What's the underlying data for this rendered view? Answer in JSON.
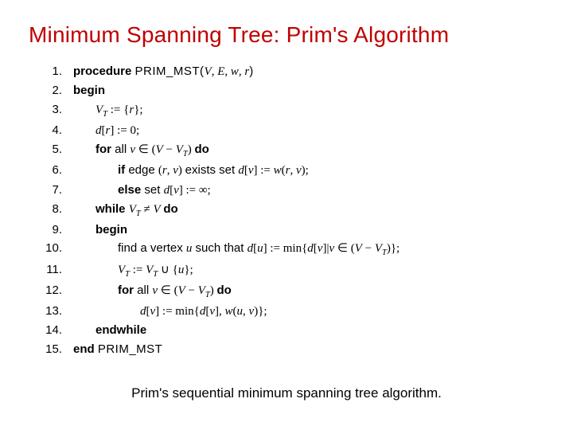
{
  "title": "Minimum Spanning Tree: Prim's Algorithm",
  "caption": "Prim's sequential minimum spanning tree algorithm.",
  "algo": {
    "lines": [
      {
        "n": "1.",
        "indent": 0,
        "parts": [
          {
            "t": "kw",
            "s": "procedure "
          },
          {
            "t": "sc",
            "s": "PRIM_MST("
          },
          {
            "t": "mi",
            "s": "V"
          },
          {
            "t": "m",
            "s": ", "
          },
          {
            "t": "mi",
            "s": "E"
          },
          {
            "t": "m",
            "s": ", "
          },
          {
            "t": "mi",
            "s": "w"
          },
          {
            "t": "m",
            "s": ", "
          },
          {
            "t": "mi",
            "s": "r"
          },
          {
            "t": "sc",
            "s": ")"
          }
        ]
      },
      {
        "n": "2.",
        "indent": 0,
        "parts": [
          {
            "t": "kw",
            "s": "begin"
          }
        ]
      },
      {
        "n": "3.",
        "indent": 1,
        "parts": [
          {
            "t": "mi",
            "s": "V"
          },
          {
            "t": "sub",
            "s": "T"
          },
          {
            "t": "m",
            "s": " := {"
          },
          {
            "t": "mi",
            "s": "r"
          },
          {
            "t": "m",
            "s": "};"
          }
        ]
      },
      {
        "n": "4.",
        "indent": 1,
        "parts": [
          {
            "t": "mi",
            "s": "d"
          },
          {
            "t": "m",
            "s": "["
          },
          {
            "t": "mi",
            "s": "r"
          },
          {
            "t": "m",
            "s": "] := 0;"
          }
        ]
      },
      {
        "n": "5.",
        "indent": 1,
        "parts": [
          {
            "t": "kw",
            "s": "for "
          },
          {
            "t": "txt",
            "s": "all "
          },
          {
            "t": "mi",
            "s": "v"
          },
          {
            "t": "m",
            "s": " ∈ ("
          },
          {
            "t": "mi",
            "s": "V"
          },
          {
            "t": "m",
            "s": " − "
          },
          {
            "t": "mi",
            "s": "V"
          },
          {
            "t": "sub",
            "s": "T"
          },
          {
            "t": "m",
            "s": ") "
          },
          {
            "t": "kw",
            "s": "do"
          }
        ]
      },
      {
        "n": "6.",
        "indent": 2,
        "parts": [
          {
            "t": "kw",
            "s": "if "
          },
          {
            "t": "txt",
            "s": "edge "
          },
          {
            "t": "m",
            "s": "("
          },
          {
            "t": "mi",
            "s": "r"
          },
          {
            "t": "m",
            "s": ", "
          },
          {
            "t": "mi",
            "s": "v"
          },
          {
            "t": "m",
            "s": ") "
          },
          {
            "t": "txt",
            "s": "exists set "
          },
          {
            "t": "mi",
            "s": "d"
          },
          {
            "t": "m",
            "s": "["
          },
          {
            "t": "mi",
            "s": "v"
          },
          {
            "t": "m",
            "s": "] := "
          },
          {
            "t": "mi",
            "s": "w"
          },
          {
            "t": "m",
            "s": "("
          },
          {
            "t": "mi",
            "s": "r"
          },
          {
            "t": "m",
            "s": ", "
          },
          {
            "t": "mi",
            "s": "v"
          },
          {
            "t": "m",
            "s": ");"
          }
        ]
      },
      {
        "n": "7.",
        "indent": 2,
        "parts": [
          {
            "t": "kw",
            "s": "else "
          },
          {
            "t": "txt",
            "s": "set "
          },
          {
            "t": "mi",
            "s": "d"
          },
          {
            "t": "m",
            "s": "["
          },
          {
            "t": "mi",
            "s": "v"
          },
          {
            "t": "m",
            "s": "] := ∞;"
          }
        ]
      },
      {
        "n": "8.",
        "indent": 1,
        "parts": [
          {
            "t": "kw",
            "s": "while "
          },
          {
            "t": "mi",
            "s": "V"
          },
          {
            "t": "sub",
            "s": "T"
          },
          {
            "t": "m",
            "s": " ≠ "
          },
          {
            "t": "mi",
            "s": "V"
          },
          {
            "t": "m",
            "s": " "
          },
          {
            "t": "kw",
            "s": "do"
          }
        ]
      },
      {
        "n": "9.",
        "indent": 1,
        "parts": [
          {
            "t": "kw",
            "s": "begin"
          }
        ]
      },
      {
        "n": "10.",
        "indent": 2,
        "parts": [
          {
            "t": "txt",
            "s": "find a vertex "
          },
          {
            "t": "mi",
            "s": "u"
          },
          {
            "t": "txt",
            "s": " such that "
          },
          {
            "t": "mi",
            "s": "d"
          },
          {
            "t": "m",
            "s": "["
          },
          {
            "t": "mi",
            "s": "u"
          },
          {
            "t": "m",
            "s": "] := min{"
          },
          {
            "t": "mi",
            "s": "d"
          },
          {
            "t": "m",
            "s": "["
          },
          {
            "t": "mi",
            "s": "v"
          },
          {
            "t": "m",
            "s": "]|"
          },
          {
            "t": "mi",
            "s": "v"
          },
          {
            "t": "m",
            "s": " ∈ ("
          },
          {
            "t": "mi",
            "s": "V"
          },
          {
            "t": "m",
            "s": " − "
          },
          {
            "t": "mi",
            "s": "V"
          },
          {
            "t": "sub",
            "s": "T"
          },
          {
            "t": "m",
            "s": ")};"
          }
        ]
      },
      {
        "n": "11.",
        "indent": 2,
        "parts": [
          {
            "t": "mi",
            "s": "V"
          },
          {
            "t": "sub",
            "s": "T"
          },
          {
            "t": "m",
            "s": " := "
          },
          {
            "t": "mi",
            "s": "V"
          },
          {
            "t": "sub",
            "s": "T"
          },
          {
            "t": "m",
            "s": " ∪ {"
          },
          {
            "t": "mi",
            "s": "u"
          },
          {
            "t": "m",
            "s": "};"
          }
        ]
      },
      {
        "n": "12.",
        "indent": 2,
        "parts": [
          {
            "t": "kw",
            "s": "for "
          },
          {
            "t": "txt",
            "s": "all "
          },
          {
            "t": "mi",
            "s": "v"
          },
          {
            "t": "m",
            "s": " ∈ ("
          },
          {
            "t": "mi",
            "s": "V"
          },
          {
            "t": "m",
            "s": " − "
          },
          {
            "t": "mi",
            "s": "V"
          },
          {
            "t": "sub",
            "s": "T"
          },
          {
            "t": "m",
            "s": ") "
          },
          {
            "t": "kw",
            "s": "do"
          }
        ]
      },
      {
        "n": "13.",
        "indent": 3,
        "parts": [
          {
            "t": "mi",
            "s": "d"
          },
          {
            "t": "m",
            "s": "["
          },
          {
            "t": "mi",
            "s": "v"
          },
          {
            "t": "m",
            "s": "] := min{"
          },
          {
            "t": "mi",
            "s": "d"
          },
          {
            "t": "m",
            "s": "["
          },
          {
            "t": "mi",
            "s": "v"
          },
          {
            "t": "m",
            "s": "], "
          },
          {
            "t": "mi",
            "s": "w"
          },
          {
            "t": "m",
            "s": "("
          },
          {
            "t": "mi",
            "s": "u"
          },
          {
            "t": "m",
            "s": ", "
          },
          {
            "t": "mi",
            "s": "v"
          },
          {
            "t": "m",
            "s": ")};"
          }
        ]
      },
      {
        "n": "14.",
        "indent": 1,
        "parts": [
          {
            "t": "kw",
            "s": "endwhile"
          }
        ]
      },
      {
        "n": "15.",
        "indent": 0,
        "parts": [
          {
            "t": "kw",
            "s": "end "
          },
          {
            "t": "sc",
            "s": "PRIM_MST"
          }
        ]
      }
    ]
  }
}
